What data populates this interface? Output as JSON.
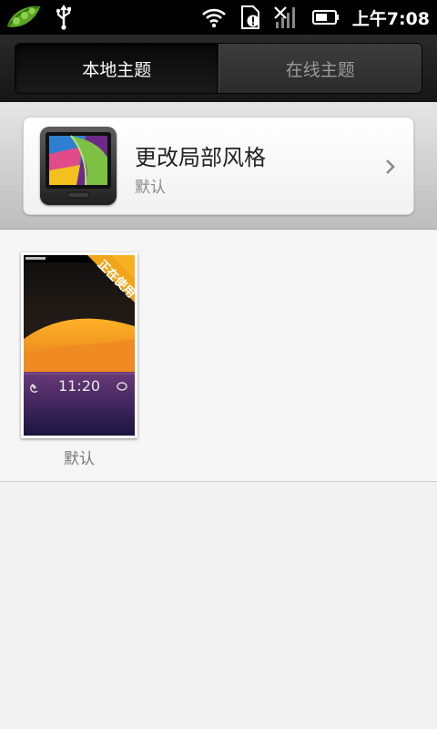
{
  "status_bar": {
    "time": "上午7:08",
    "icons": [
      "pea-pod-app-icon",
      "usb-icon",
      "wifi-icon",
      "sd-card-alert-icon",
      "no-signal-icon",
      "battery-icon"
    ]
  },
  "tabs": [
    {
      "label": "本地主题",
      "active": true
    },
    {
      "label": "在线主题",
      "active": false
    }
  ],
  "custom_style_card": {
    "title": "更改局部风格",
    "subtitle": "默认",
    "icon": "theme-style-icon"
  },
  "themes": [
    {
      "name": "默认",
      "badge": "正在使用",
      "preview_time": "11:20"
    }
  ],
  "colors": {
    "status_bar_bg": "#000000",
    "tab_active_text": "#ffffff",
    "tab_inactive_text": "#9a9a9a",
    "badge_bg": "#f2a51b"
  }
}
